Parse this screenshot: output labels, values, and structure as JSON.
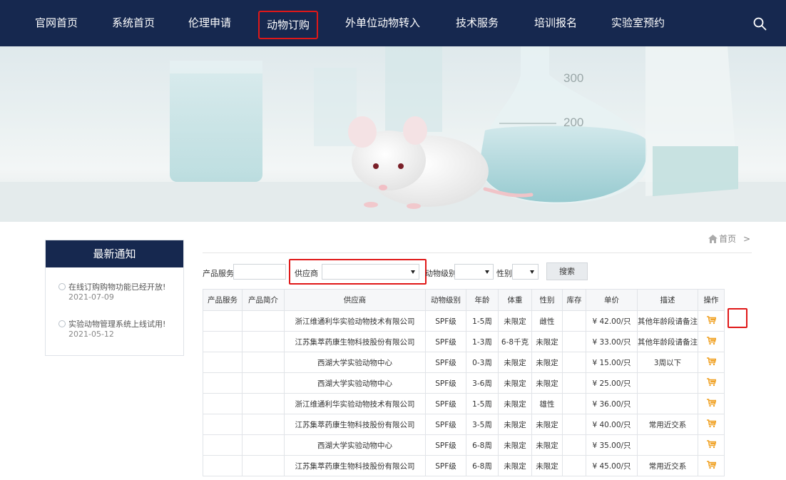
{
  "nav": {
    "items": [
      "官网首页",
      "系统首页",
      "伦理申请",
      "动物订购",
      "外单位动物转入",
      "技术服务",
      "培训报名",
      "实验室预约"
    ],
    "active": "动物订购"
  },
  "banner": {
    "marks": [
      "300",
      "200"
    ]
  },
  "sidebar": {
    "title": "最新通知",
    "notices": [
      {
        "text": "在线订购购物功能已经开放!",
        "date": "2021-07-09"
      },
      {
        "text": "实验动物管理系统上线试用!",
        "date": "2021-05-12"
      }
    ]
  },
  "breadcrumb": {
    "home": "首页",
    "sep": ">"
  },
  "filters": {
    "product_label": "产品服务",
    "supplier_label": "供应商",
    "level_label": "动物级别",
    "sex_label": "性别",
    "search_label": "搜索"
  },
  "table": {
    "headers": [
      "产品服务",
      "产品简介",
      "供应商",
      "动物级别",
      "年龄",
      "体重",
      "性别",
      "库存",
      "单价",
      "描述",
      "操作"
    ],
    "rows": [
      [
        "",
        "",
        "浙江维通利华实验动物技术有限公司",
        "SPF级",
        "1-5周",
        "未限定",
        "雌性",
        "",
        "¥ 42.00/只",
        "其他年龄段请备注"
      ],
      [
        "",
        "",
        "江苏集萃药康生物科技股份有限公司",
        "SPF级",
        "1-3周",
        "6-8千克",
        "未限定",
        "",
        "¥ 33.00/只",
        "其他年龄段请备注"
      ],
      [
        "",
        "",
        "西湖大学实验动物中心",
        "SPF级",
        "0-3周",
        "未限定",
        "未限定",
        "",
        "¥ 15.00/只",
        "3周以下"
      ],
      [
        "",
        "",
        "西湖大学实验动物中心",
        "SPF级",
        "3-6周",
        "未限定",
        "未限定",
        "",
        "¥ 25.00/只",
        ""
      ],
      [
        "",
        "",
        "浙江维通利华实验动物技术有限公司",
        "SPF级",
        "1-5周",
        "未限定",
        "雄性",
        "",
        "¥ 36.00/只",
        ""
      ],
      [
        "",
        "",
        "江苏集萃药康生物科技股份有限公司",
        "SPF级",
        "3-5周",
        "未限定",
        "未限定",
        "",
        "¥ 40.00/只",
        "常用近交系"
      ],
      [
        "",
        "",
        "西湖大学实验动物中心",
        "SPF级",
        "6-8周",
        "未限定",
        "未限定",
        "",
        "¥ 35.00/只",
        ""
      ],
      [
        "",
        "",
        "江苏集萃药康生物科技股份有限公司",
        "SPF级",
        "6-8周",
        "未限定",
        "未限定",
        "",
        "¥ 45.00/只",
        "常用近交系"
      ]
    ]
  },
  "colors": {
    "nav_bg": "#16284f",
    "highlight": "#e01818",
    "cart": "#f0a020"
  },
  "icons": {
    "search": "search-icon",
    "home": "home-icon",
    "cart": "cart-icon",
    "notice": "circle-bullet-icon"
  }
}
